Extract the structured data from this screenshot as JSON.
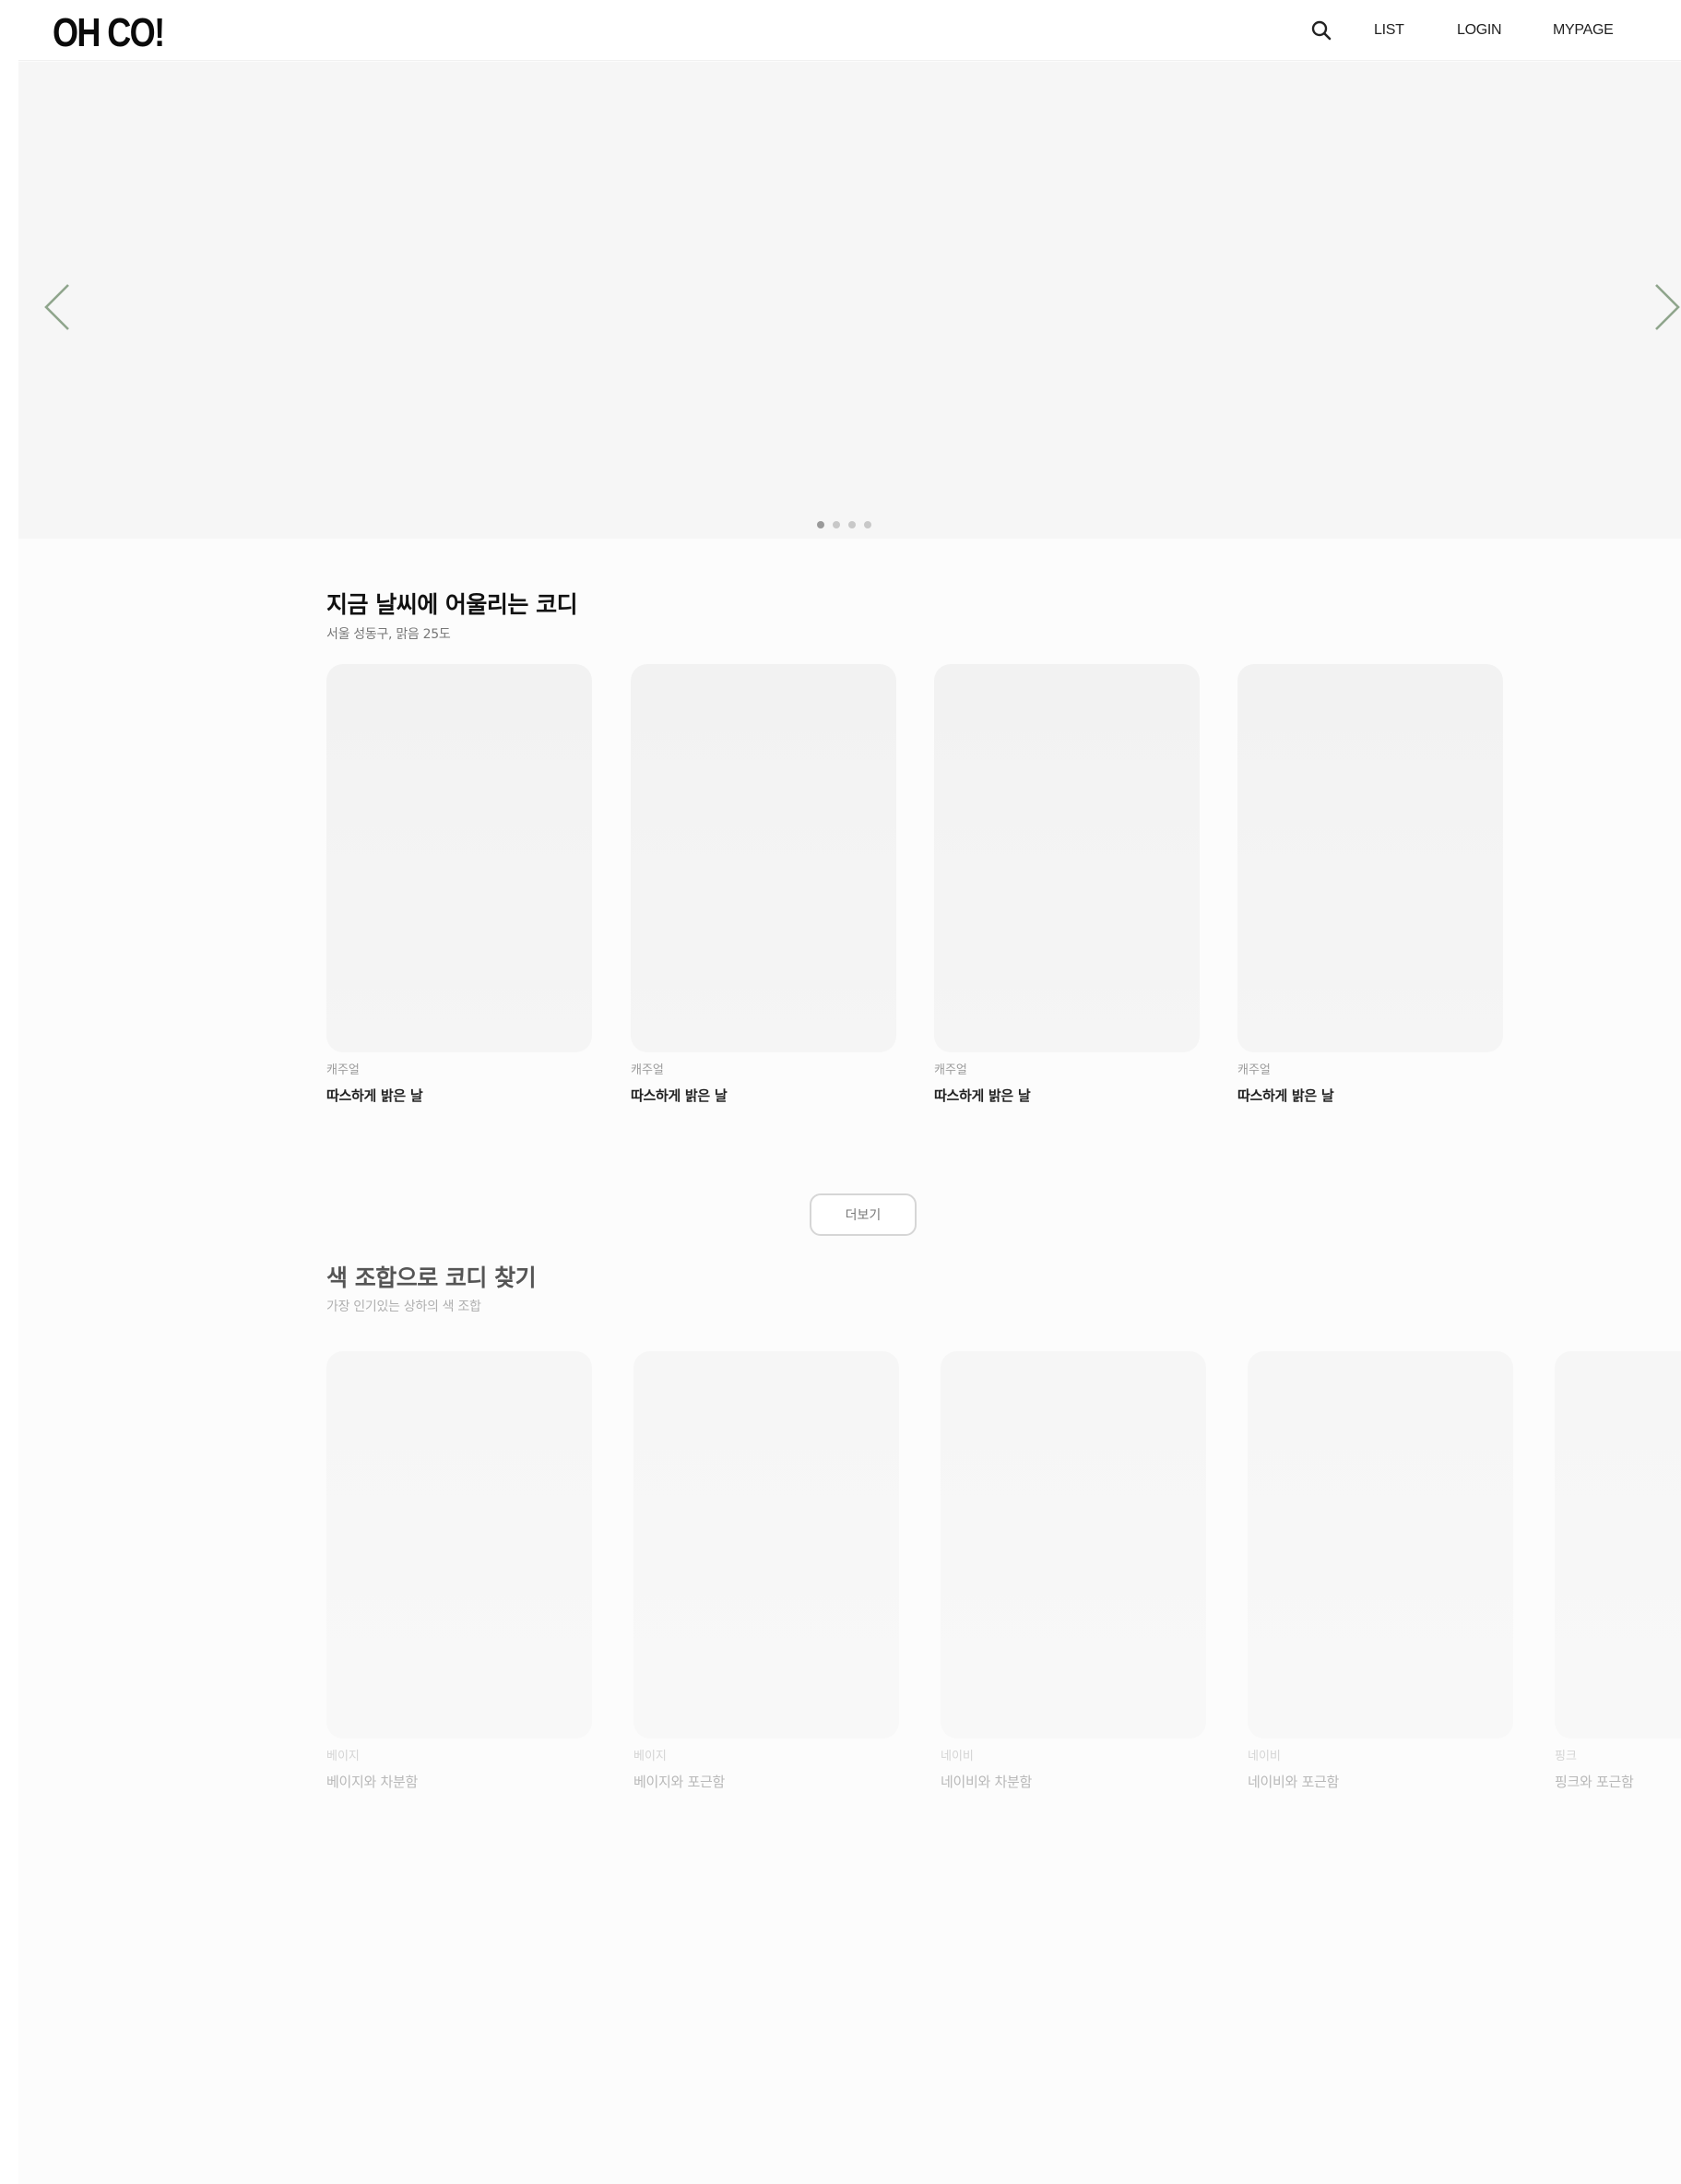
{
  "header": {
    "logo": "OH CO!",
    "nav": [
      "LIST",
      "LOGIN",
      "MYPAGE"
    ]
  },
  "hero": {
    "slide_count": 4,
    "active_slide": 1
  },
  "weather_section": {
    "title": "지금 날씨에 어울리는 코디",
    "subtitle": "서울 성동구, 맑음 25도",
    "cards": [
      {
        "category": "캐주얼",
        "title": "따스하게 밝은 날"
      },
      {
        "category": "캐주얼",
        "title": "따스하게 밝은 날"
      },
      {
        "category": "캐주얼",
        "title": "따스하게 밝은 날"
      },
      {
        "category": "캐주얼",
        "title": "따스하게 밝은 날"
      }
    ],
    "more_label": "더보기"
  },
  "color_section": {
    "title": "색 조합으로 코디 찾기",
    "subtitle": "가장 인기있는 상하의 색 조합",
    "cards": [
      {
        "category": "베이지",
        "title": "베이지와 차분함"
      },
      {
        "category": "베이지",
        "title": "베이지와 포근함"
      },
      {
        "category": "네이비",
        "title": "네이비와 차분함"
      },
      {
        "category": "네이비",
        "title": "네이비와 포근함"
      },
      {
        "category": "핑크",
        "title": "핑크와 포근함"
      }
    ]
  },
  "colors": {
    "arrow": "#8fa58c",
    "background": "#fcfcfc",
    "card_placeholder": "#f2f2f2"
  }
}
